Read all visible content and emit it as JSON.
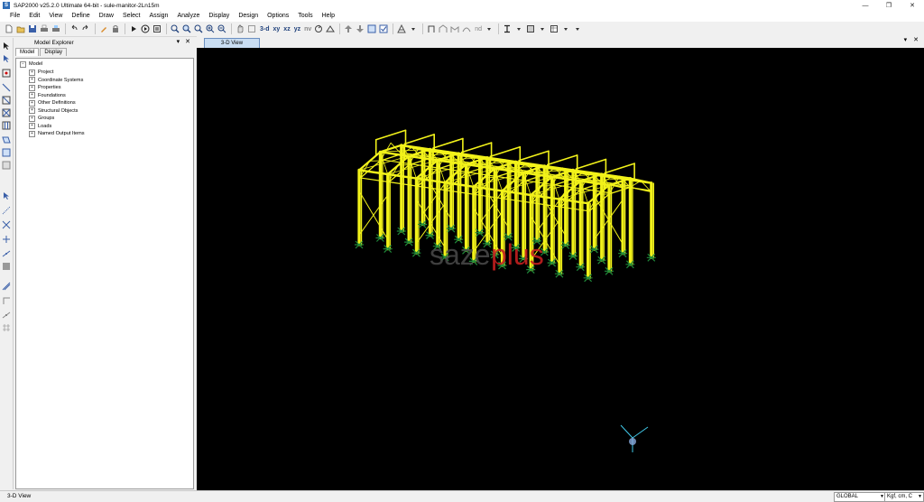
{
  "window": {
    "title": "SAP2000 v25.2.0 Ultimate 64-bit - sule-manitor-2Ln15m",
    "logo_text": "S",
    "minimize": "—",
    "maximize": "❐",
    "close": "✕"
  },
  "menu": [
    "File",
    "Edit",
    "View",
    "Define",
    "Draw",
    "Select",
    "Assign",
    "Analyze",
    "Display",
    "Design",
    "Options",
    "Tools",
    "Help"
  ],
  "toolbar": {
    "view_3d": "3-d",
    "view_xy": "xy",
    "view_xz": "xz",
    "view_yz": "yz",
    "view_nv": "nv",
    "nd_label": "nd"
  },
  "explorer": {
    "title": "Model Explorer",
    "pin": "▾",
    "close": "✕",
    "tabs": [
      "Model",
      "Display"
    ],
    "root": "Model",
    "items": [
      "Project",
      "Coordinate Systems",
      "Properties",
      "Foundations",
      "Other Definitions",
      "Structural Objects",
      "Groups",
      "Loads",
      "Named Output Items"
    ]
  },
  "view": {
    "tab_label": "3-D View",
    "pin": "▾",
    "close": "✕",
    "watermark_left": "saze",
    "watermark_right": "plus",
    "colors": {
      "frame": "#f2f21a",
      "support": "#1f8a3a",
      "axis": "#40c8e8",
      "background": "#000000"
    }
  },
  "status": {
    "text": "3-D View",
    "coord_system": "GLOBAL",
    "units": "Kgf, cm, C"
  }
}
